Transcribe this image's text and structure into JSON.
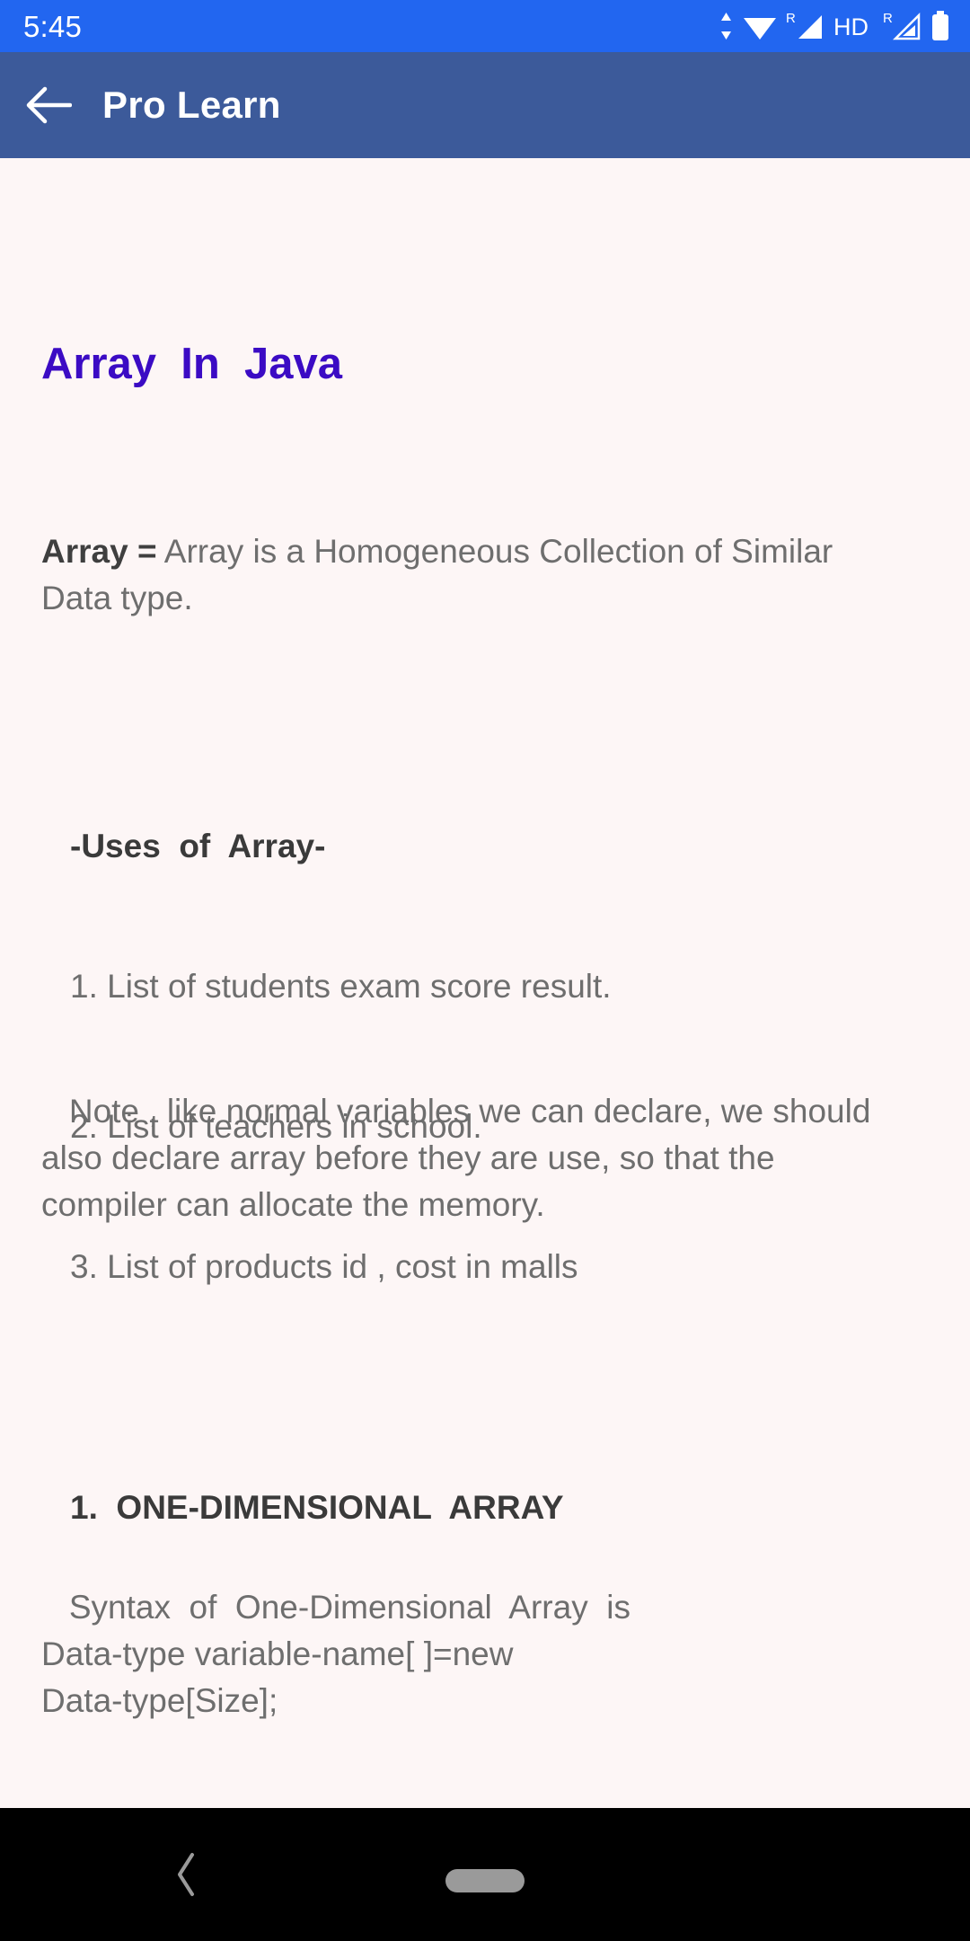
{
  "status_bar": {
    "clock": "5:45",
    "background": "#2266f0",
    "icons": [
      {
        "name": "data-transfer-icon",
        "label": "data-transfer"
      },
      {
        "name": "wifi-icon",
        "label": "wifi"
      },
      {
        "name": "signal-roaming-1-icon",
        "label": "R signal bars"
      },
      {
        "name": "hd-icon",
        "label": "HD"
      },
      {
        "name": "signal-roaming-2-icon",
        "label": "R signal bars"
      },
      {
        "name": "battery-icon",
        "label": "battery"
      }
    ]
  },
  "app_bar": {
    "title": "Pro Learn",
    "back_icon": "arrow-left-icon",
    "background": "#3c5a9a"
  },
  "content": {
    "background": "#fdf6f6",
    "lesson_title": "Array  In  Java",
    "lesson_title_color": "#3b0bc4",
    "definition": {
      "term": "Array =",
      "text": " Array is a Homogeneous Collection of Similar Data type."
    },
    "uses": {
      "heading": "-Uses  of  Array-",
      "items": [
        "1. List of students exam score result.",
        "2. List of teachers in school.",
        "3. List of products id , cost in malls"
      ]
    },
    "note": "   Note , like normal variables we can declare, we should also declare array before they are use, so that the compiler can allocate the memory.",
    "section_heading": "1.  ONE-DIMENSIONAL  ARRAY",
    "syntax": "   Syntax  of  One-Dimensional  Array  is\nData-type variable-name[ ]=new\nData-type[Size];"
  },
  "nav_bar": {
    "background": "#000000",
    "back_icon": "chevron-left-icon",
    "home_pill": "home-pill-handle"
  }
}
